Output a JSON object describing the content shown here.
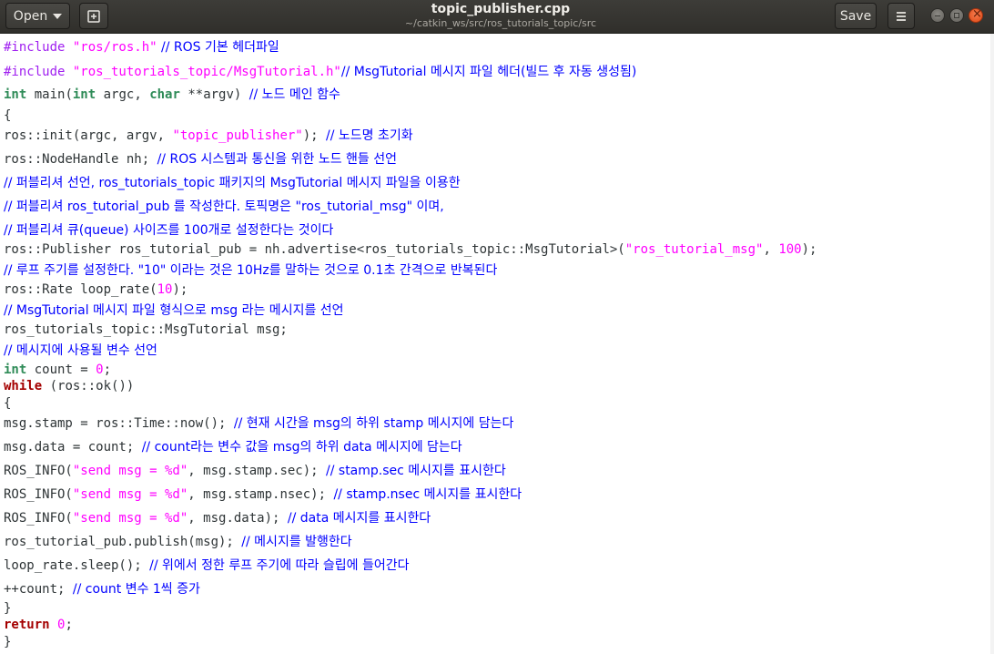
{
  "header": {
    "open_label": "Open",
    "title": "topic_publisher.cpp",
    "subtitle": "~/catkin_ws/src/ros_tutorials_topic/src",
    "save_label": "Save"
  },
  "code": {
    "l1": {
      "pp": "#include ",
      "st": "\"ros/ros.h\"",
      "cm": " // ROS 기본 헤더파일"
    },
    "l2": {
      "pp": "#include ",
      "st": "\"ros_tutorials_topic/MsgTutorial.h\"",
      "cm": "// MsgTutorial 메시지 파일 헤더(빌드 후 자동 생성됨)"
    },
    "l3": {
      "t1": "int",
      "a": " main(",
      "t2": "int",
      "b": " argc, ",
      "t3": "char",
      "c": " **argv) ",
      "cm": "// 노드 메인 함수"
    },
    "l4": {
      "a": "{"
    },
    "l5": {
      "a": "ros::init(argc, argv, ",
      "st": "\"topic_publisher\"",
      "b": "); ",
      "cm": "// 노드명 초기화"
    },
    "l6": {
      "a": "ros::NodeHandle nh; ",
      "cm": "// ROS 시스템과 통신을 위한 노드 핸들 선언"
    },
    "l7": {
      "cm": "// 퍼블리셔 선언, ros_tutorials_topic 패키지의 MsgTutorial 메시지 파일을 이용한"
    },
    "l8": {
      "cm": "// 퍼블리셔 ros_tutorial_pub 를 작성한다. 토픽명은 \"ros_tutorial_msg\" 이며,"
    },
    "l9": {
      "cm": "// 퍼블리셔 큐(queue) 사이즈를 100개로 설정한다는 것이다"
    },
    "l10": {
      "a": "ros::Publisher ros_tutorial_pub = nh.advertise<ros_tutorials_topic::MsgTutorial>(",
      "st": "\"ros_tutorial_msg\"",
      "b": ", ",
      "nm": "100",
      "c": ");"
    },
    "l11": {
      "cm": "// 루프 주기를 설정한다. \"10\" 이라는 것은 10Hz를 말하는 것으로 0.1초 간격으로 반복된다"
    },
    "l12": {
      "a": "ros::Rate loop_rate(",
      "nm": "10",
      "b": ");"
    },
    "l13": {
      "cm": "// MsgTutorial 메시지 파일 형식으로 msg 라는 메시지를 선언"
    },
    "l14": {
      "a": "ros_tutorials_topic::MsgTutorial msg;"
    },
    "l15": {
      "cm": "// 메시지에 사용될 변수 선언"
    },
    "l16": {
      "ty": "int",
      "a": " count = ",
      "nm": "0",
      "b": ";"
    },
    "l17": {
      "kw": "while",
      "a": " (ros::ok())"
    },
    "l18": {
      "a": "{"
    },
    "l19": {
      "a": "msg.stamp = ros::Time::now(); ",
      "cm": "// 현재 시간을 msg의 하위 stamp 메시지에 담는다"
    },
    "l20": {
      "a": "msg.data = count; ",
      "cm": "// count라는 변수 값을 msg의 하위 data 메시지에 담는다"
    },
    "l21": {
      "a": "ROS_INFO(",
      "st": "\"send msg = %d\"",
      "b": ", msg.stamp.sec); ",
      "cm": "// stamp.sec 메시지를 표시한다"
    },
    "l22": {
      "a": "ROS_INFO(",
      "st": "\"send msg = %d\"",
      "b": ", msg.stamp.nsec); ",
      "cm": "// stamp.nsec 메시지를 표시한다"
    },
    "l23": {
      "a": "ROS_INFO(",
      "st": "\"send msg = %d\"",
      "b": ", msg.data); ",
      "cm": "// data 메시지를 표시한다"
    },
    "l24": {
      "a": "ros_tutorial_pub.publish(msg); ",
      "cm": "// 메시지를 발행한다"
    },
    "l25": {
      "a": "loop_rate.sleep(); ",
      "cm": "// 위에서 정한 루프 주기에 따라 슬립에 들어간다"
    },
    "l26": {
      "a": "++count; ",
      "cm": "// count 변수 1씩 증가"
    },
    "l27": {
      "a": "}"
    },
    "l28": {
      "kw": "return",
      "a": " ",
      "nm": "0",
      "b": ";"
    },
    "l29": {
      "a": "}"
    }
  }
}
